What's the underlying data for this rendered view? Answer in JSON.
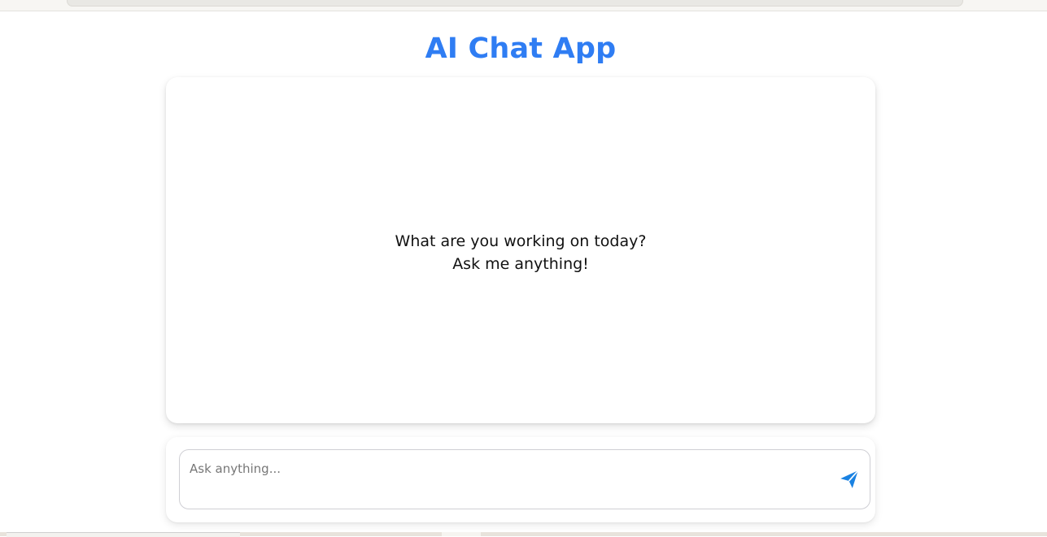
{
  "app": {
    "title": "AI Chat App"
  },
  "chat": {
    "welcome_line1": "What are you working on today?",
    "welcome_line2": "Ask me anything!"
  },
  "composer": {
    "placeholder": "Ask anything...",
    "value": "",
    "send_icon": "send-icon"
  },
  "colors": {
    "accent": "#2f7df3",
    "send_icon": "#1a82e2"
  }
}
